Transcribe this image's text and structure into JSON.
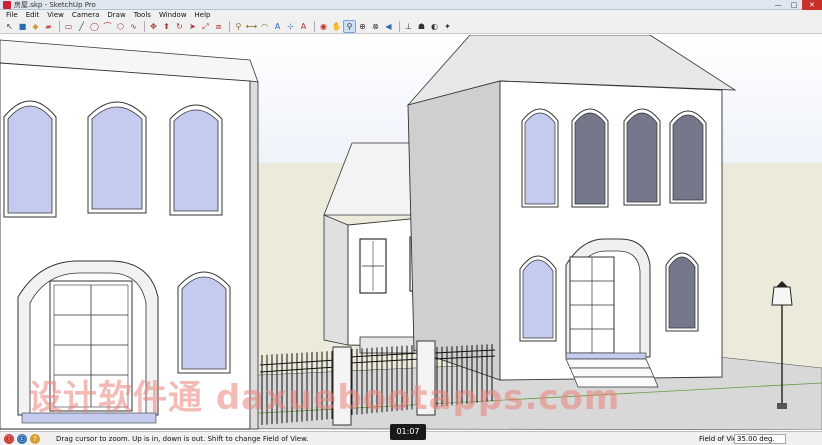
{
  "window": {
    "title": "房屋.skp - SketchUp Pro",
    "minimize": "—",
    "maximize": "□",
    "close": "✕"
  },
  "menu": [
    "File",
    "Edit",
    "View",
    "Camera",
    "Draw",
    "Tools",
    "Window",
    "Help"
  ],
  "toolbar": {
    "tools": [
      {
        "name": "select-tool",
        "glyph": "↖",
        "color": "#333"
      },
      {
        "name": "component-tool",
        "glyph": "■",
        "color": "#2b6cb0"
      },
      {
        "name": "paint-bucket-tool",
        "glyph": "◆",
        "color": "#d69e2e"
      },
      {
        "name": "eraser-tool",
        "glyph": "▰",
        "color": "#d05050"
      },
      {
        "sep": true
      },
      {
        "name": "rectangle-tool",
        "glyph": "▭",
        "color": "#8b3a3a"
      },
      {
        "name": "line-tool",
        "glyph": "╱",
        "color": "#333"
      },
      {
        "name": "circle-tool",
        "glyph": "◯",
        "color": "#b03030"
      },
      {
        "name": "arc-tool",
        "glyph": "⌒",
        "color": "#b03030"
      },
      {
        "name": "polygon-tool",
        "glyph": "⬡",
        "color": "#b03030"
      },
      {
        "name": "freehand-tool",
        "glyph": "∿",
        "color": "#b03030"
      },
      {
        "sep": true
      },
      {
        "name": "move-tool",
        "glyph": "✥",
        "color": "#b03030"
      },
      {
        "name": "push-pull-tool",
        "glyph": "⬆",
        "color": "#b03030"
      },
      {
        "name": "rotate-tool",
        "glyph": "↻",
        "color": "#b03030"
      },
      {
        "name": "follow-me-tool",
        "glyph": "➤",
        "color": "#b03030"
      },
      {
        "name": "scale-tool",
        "glyph": "⤢",
        "color": "#b03030"
      },
      {
        "name": "offset-tool",
        "glyph": "⧈",
        "color": "#b03030"
      },
      {
        "sep": true
      },
      {
        "name": "tape-measure-tool",
        "glyph": "⚲",
        "color": "#8b6914"
      },
      {
        "name": "dimension-tool",
        "glyph": "⟷",
        "color": "#8b6914"
      },
      {
        "name": "protractor-tool",
        "glyph": "◠",
        "color": "#8b6914"
      },
      {
        "name": "text-tool",
        "glyph": "A",
        "color": "#2b6cb0"
      },
      {
        "name": "axes-tool",
        "glyph": "⊹",
        "color": "#2b6cb0"
      },
      {
        "name": "3d-text-tool",
        "glyph": "A",
        "color": "#b03030"
      },
      {
        "sep": true
      },
      {
        "name": "orbit-tool",
        "glyph": "◉",
        "color": "#b03030"
      },
      {
        "name": "pan-tool",
        "glyph": "✋",
        "color": "#333"
      },
      {
        "name": "zoom-tool",
        "glyph": "⚲",
        "color": "#333",
        "active": true
      },
      {
        "name": "zoom-window-tool",
        "glyph": "⊕",
        "color": "#333"
      },
      {
        "name": "zoom-extents-tool",
        "glyph": "⊗",
        "color": "#333"
      },
      {
        "name": "previous-view-tool",
        "glyph": "◀",
        "color": "#2b6cb0"
      },
      {
        "sep": true
      },
      {
        "name": "position-camera-tool",
        "glyph": "⊥",
        "color": "#333"
      },
      {
        "name": "walk-tool",
        "glyph": "☗",
        "color": "#333"
      },
      {
        "name": "look-around-tool",
        "glyph": "◐",
        "color": "#333"
      },
      {
        "name": "section-plane-tool",
        "glyph": "✦",
        "color": "#333"
      }
    ]
  },
  "watermark": "设计软件通 daxuebootapps.com",
  "time_badge": "01:07",
  "status": {
    "message": "Drag cursor to zoom.  Up is in, down is out. Shift to change Field of View.",
    "vcb_label": "Field of View",
    "vcb_value": "35.00 deg."
  },
  "colors": {
    "sky": "#eef3fa",
    "ground": "#eceadb",
    "window_glass": "#c4cbee",
    "accent": "#c8302a"
  }
}
